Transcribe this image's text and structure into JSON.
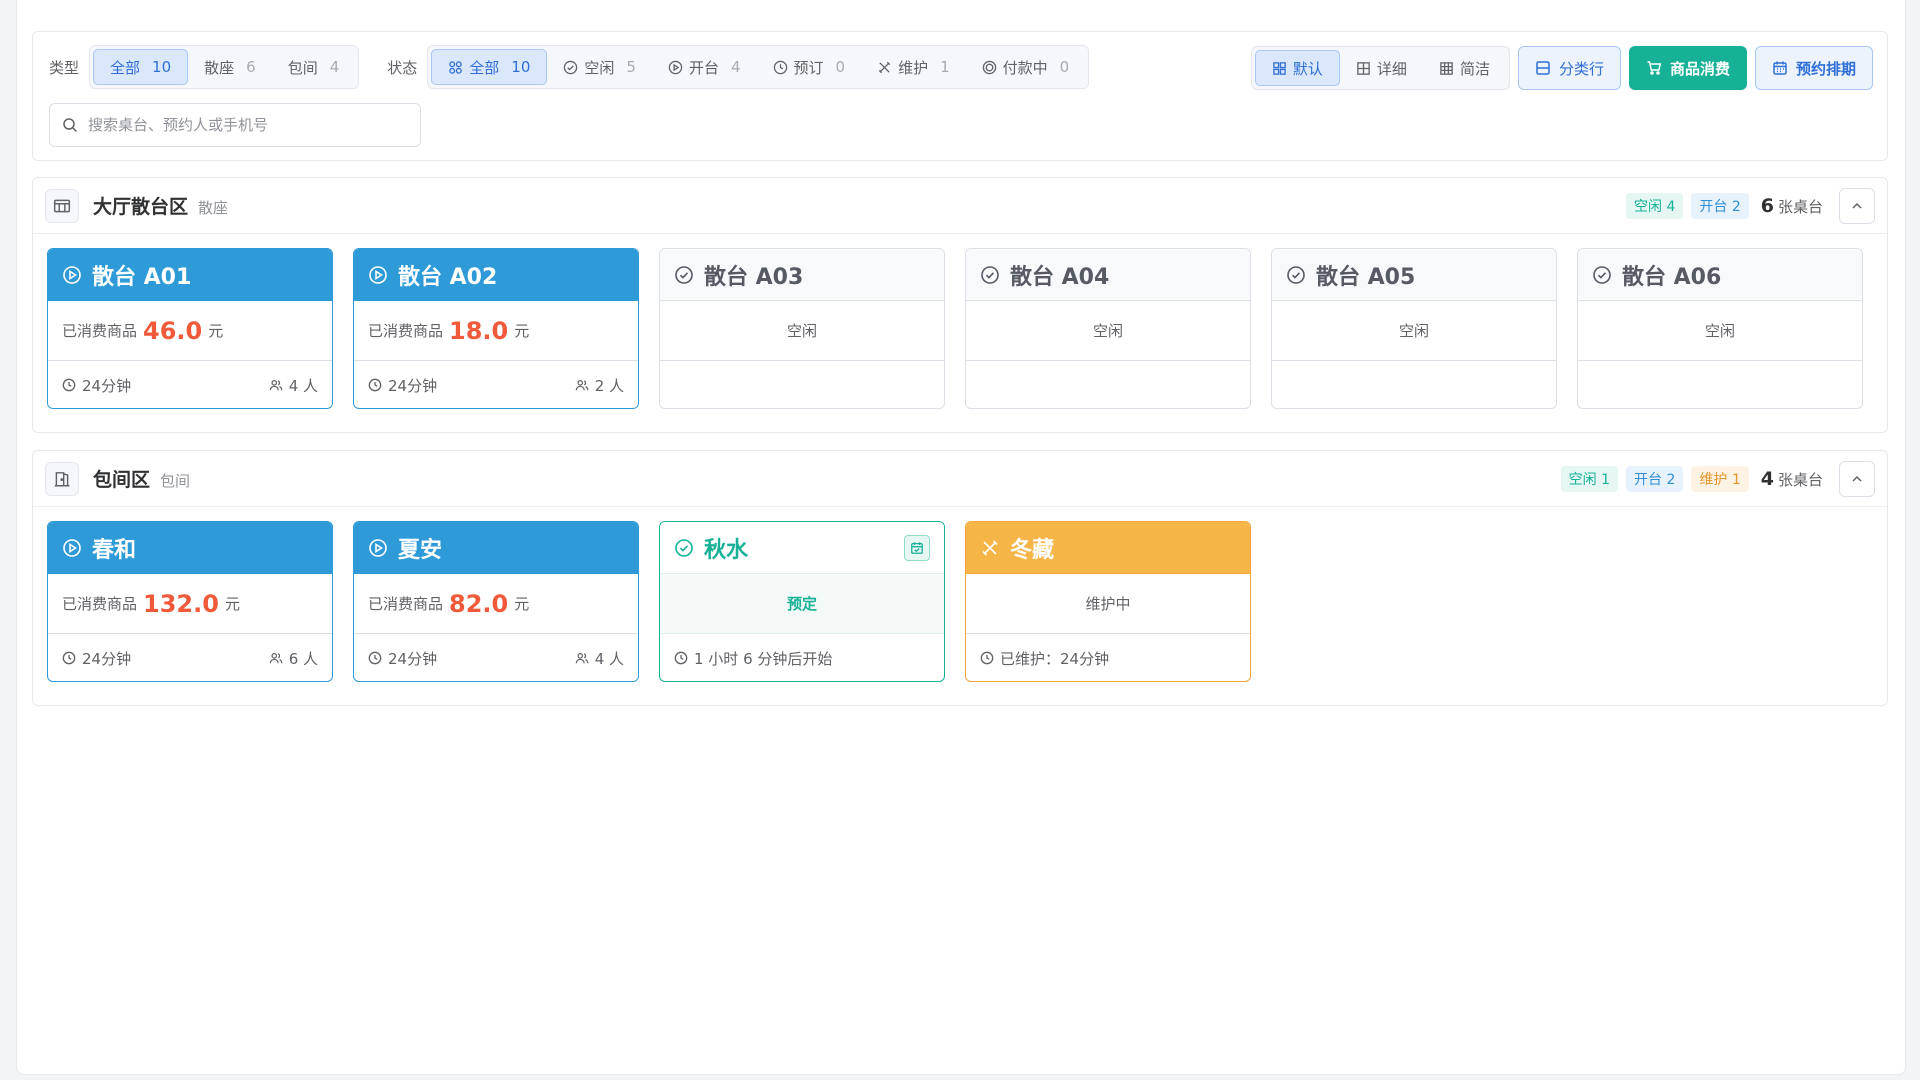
{
  "filters": {
    "type_label": "类型",
    "type_options": [
      {
        "label": "全部",
        "count": "10"
      },
      {
        "label": "散座",
        "count": "6"
      },
      {
        "label": "包间",
        "count": "4"
      }
    ],
    "status_label": "状态",
    "status_options": [
      {
        "label": "全部",
        "count": "10"
      },
      {
        "label": "空闲",
        "count": "5"
      },
      {
        "label": "开台",
        "count": "4"
      },
      {
        "label": "预订",
        "count": "0"
      },
      {
        "label": "维护",
        "count": "1"
      },
      {
        "label": "付款中",
        "count": "0"
      }
    ],
    "view_options": [
      "默认",
      "详细",
      "简洁"
    ],
    "group_button": "分类行",
    "consume_button": "商品消费",
    "booking_button": "预约排期",
    "search_placeholder": "搜索桌台、预约人或手机号"
  },
  "areas": [
    {
      "name": "大厅散台区",
      "type": "散座",
      "tags": {
        "idle": "空闲 4",
        "open": "开台 2"
      },
      "count": "6",
      "count_unit": "张桌台",
      "tables": [
        {
          "name": "散台 A01",
          "consumed_label": "已消费商品",
          "amount": "46.0",
          "unit": "元",
          "duration": "24分钟",
          "people": "4 人"
        },
        {
          "name": "散台 A02",
          "consumed_label": "已消费商品",
          "amount": "18.0",
          "unit": "元",
          "duration": "24分钟",
          "people": "2 人"
        },
        {
          "name": "散台 A03",
          "status": "空闲"
        },
        {
          "name": "散台 A04",
          "status": "空闲"
        },
        {
          "name": "散台 A05",
          "status": "空闲"
        },
        {
          "name": "散台 A06",
          "status": "空闲"
        }
      ]
    },
    {
      "name": "包间区",
      "type": "包间",
      "tags": {
        "idle": "空闲 1",
        "open": "开台 2",
        "maint": "维护 1"
      },
      "count": "4",
      "count_unit": "张桌台",
      "tables": [
        {
          "name": "春和",
          "consumed_label": "已消费商品",
          "amount": "132.0",
          "unit": "元",
          "duration": "24分钟",
          "people": "6 人"
        },
        {
          "name": "夏安",
          "consumed_label": "已消费商品",
          "amount": "82.0",
          "unit": "元",
          "duration": "24分钟",
          "people": "4 人"
        },
        {
          "name": "秋水",
          "status": "预定",
          "footer": "1 小时 6 分钟后开始"
        },
        {
          "name": "冬藏",
          "status": "维护中",
          "footer": "已维护：24分钟"
        }
      ]
    }
  ],
  "colors": {
    "primary": "#2f6fd6",
    "open": "#2f9ad8",
    "green": "#17b197",
    "maintenance": "#f6b547",
    "amount": "#f05a3a"
  }
}
